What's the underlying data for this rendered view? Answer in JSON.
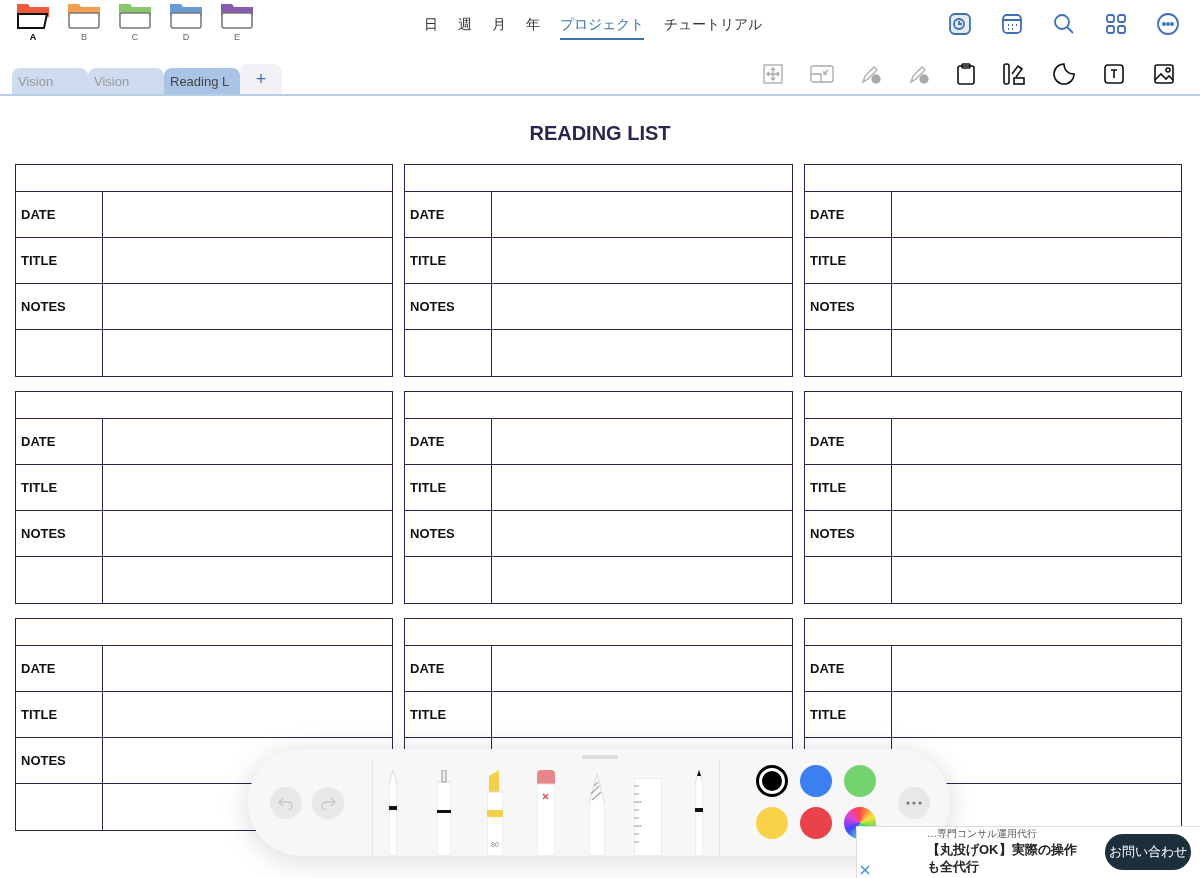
{
  "folders": [
    {
      "label": "A",
      "color": "#f05a3c",
      "selected": true
    },
    {
      "label": "B",
      "color": "#f0a050",
      "selected": false
    },
    {
      "label": "C",
      "color": "#8ac66a",
      "selected": false
    },
    {
      "label": "D",
      "color": "#6a9ad6",
      "selected": false
    },
    {
      "label": "E",
      "color": "#8a5ab0",
      "selected": false
    }
  ],
  "nav": [
    {
      "label": "日",
      "selected": false
    },
    {
      "label": "週",
      "selected": false
    },
    {
      "label": "月",
      "selected": false
    },
    {
      "label": "年",
      "selected": false
    },
    {
      "label": "プロジェクト",
      "selected": true
    },
    {
      "label": "チュートリアル",
      "selected": false
    }
  ],
  "tabs": [
    {
      "label": "Vision",
      "selected": false
    },
    {
      "label": "Vision",
      "selected": false
    },
    {
      "label": "Reading L",
      "selected": true
    }
  ],
  "add_tab": "+",
  "page_title": "READING LIST",
  "cards": [
    {
      "labels": [
        "DATE",
        "TITLE",
        "NOTES"
      ]
    },
    {
      "labels": [
        "DATE",
        "TITLE",
        "NOTES"
      ]
    },
    {
      "labels": [
        "DATE",
        "TITLE",
        "NOTES"
      ]
    },
    {
      "labels": [
        "DATE",
        "TITLE",
        "NOTES"
      ]
    },
    {
      "labels": [
        "DATE",
        "TITLE",
        "NOTES"
      ]
    },
    {
      "labels": [
        "DATE",
        "TITLE",
        "NOTES"
      ]
    },
    {
      "labels": [
        "DATE",
        "TITLE",
        "NOTES"
      ]
    },
    {
      "labels": [
        "DATE",
        "TITLE"
      ]
    },
    {
      "labels": [
        "DATE",
        "TITLE"
      ]
    }
  ],
  "pen_tools": [
    {
      "kind": "pen"
    },
    {
      "kind": "fineliner"
    },
    {
      "kind": "marker",
      "label": "80"
    },
    {
      "kind": "eraser"
    },
    {
      "kind": "lasso"
    },
    {
      "kind": "ruler"
    },
    {
      "kind": "pencil"
    }
  ],
  "colors": [
    {
      "color": "#000000",
      "selected": true
    },
    {
      "color": "#3b7ff0",
      "selected": false
    },
    {
      "color": "#74d36e",
      "selected": false
    },
    {
      "color": "#f9d24a",
      "selected": false
    },
    {
      "color": "#e8434a",
      "selected": false
    }
  ],
  "ad": {
    "caption": "…専門コンサル運用代行",
    "headline": "【丸投げOK】実際の操作も全代行",
    "button": "お問い合わせ"
  }
}
